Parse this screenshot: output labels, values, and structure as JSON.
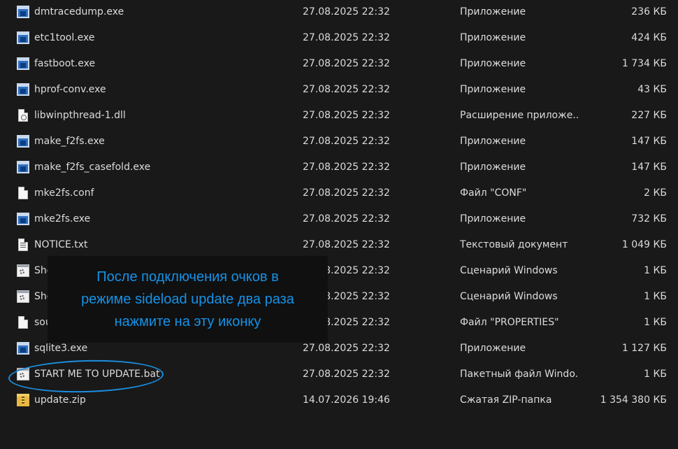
{
  "files": [
    {
      "name": "dmtracedump.exe",
      "date": "27.08.2025 22:32",
      "type": "Приложение",
      "size": "236 КБ",
      "icon": "exe"
    },
    {
      "name": "etc1tool.exe",
      "date": "27.08.2025 22:32",
      "type": "Приложение",
      "size": "424 КБ",
      "icon": "exe"
    },
    {
      "name": "fastboot.exe",
      "date": "27.08.2025 22:32",
      "type": "Приложение",
      "size": "1 734 КБ",
      "icon": "exe"
    },
    {
      "name": "hprof-conv.exe",
      "date": "27.08.2025 22:32",
      "type": "Приложение",
      "size": "43 КБ",
      "icon": "exe"
    },
    {
      "name": "libwinpthread-1.dll",
      "date": "27.08.2025 22:32",
      "type": "Расширение приложе...",
      "size": "227 КБ",
      "icon": "dll"
    },
    {
      "name": "make_f2fs.exe",
      "date": "27.08.2025 22:32",
      "type": "Приложение",
      "size": "147 КБ",
      "icon": "exe"
    },
    {
      "name": "make_f2fs_casefold.exe",
      "date": "27.08.2025 22:32",
      "type": "Приложение",
      "size": "147 КБ",
      "icon": "exe"
    },
    {
      "name": "mke2fs.conf",
      "date": "27.08.2025 22:32",
      "type": "Файл \"CONF\"",
      "size": "2 КБ",
      "icon": "doc"
    },
    {
      "name": "mke2fs.exe",
      "date": "27.08.2025 22:32",
      "type": "Приложение",
      "size": "732 КБ",
      "icon": "exe"
    },
    {
      "name": "NOTICE.txt",
      "date": "27.08.2025 22:32",
      "type": "Текстовый документ",
      "size": "1 049 КБ",
      "icon": "txt"
    },
    {
      "name": "She",
      "date": "27.08.2025 22:32",
      "type": "Сценарий Windows",
      "size": "1 КБ",
      "icon": "script"
    },
    {
      "name": "She",
      "date": "27.08.2025 22:32",
      "type": "Сценарий Windows",
      "size": "1 КБ",
      "icon": "script"
    },
    {
      "name": "sou",
      "date": "27.08.2025 22:32",
      "type": "Файл \"PROPERTIES\"",
      "size": "1 КБ",
      "icon": "doc"
    },
    {
      "name": "sqlite3.exe",
      "date": "27.08.2025 22:32",
      "type": "Приложение",
      "size": "1 127 КБ",
      "icon": "exe"
    },
    {
      "name": "START ME TO UPDATE.bat",
      "date": "27.08.2025 22:32",
      "type": "Пакетный файл Windo...",
      "size": "1 КБ",
      "icon": "script"
    },
    {
      "name": "update.zip",
      "date": "14.07.2026 19:46",
      "type": "Сжатая ZIP-папка",
      "size": "1 354 380 КБ",
      "icon": "zip"
    }
  ],
  "overlay": {
    "lines": [
      "После подключения очков в",
      "режиме sideload update два раза",
      "нажмите на эту иконку"
    ],
    "text_color": "#1592e8"
  },
  "highlight_color": "#1a8ee0"
}
